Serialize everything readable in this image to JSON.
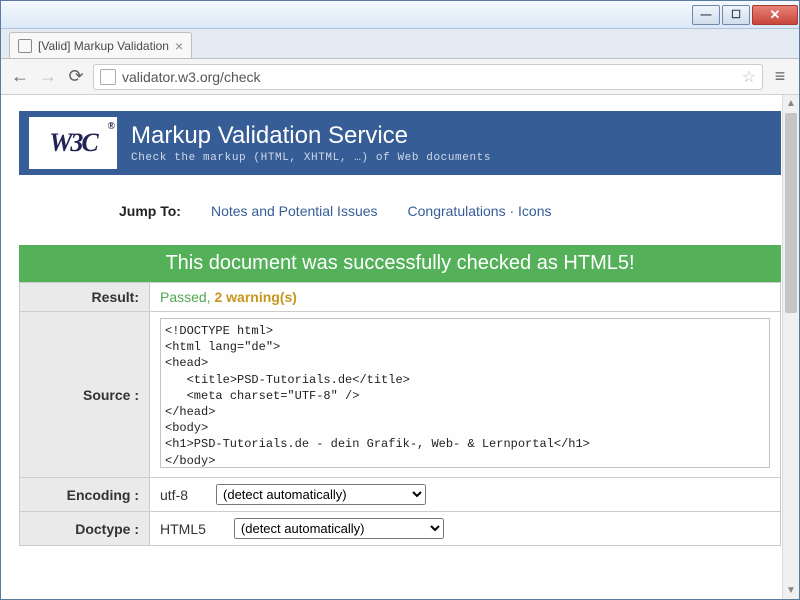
{
  "window": {
    "tab_title": "[Valid] Markup Validation"
  },
  "toolbar": {
    "url": "validator.w3.org/check"
  },
  "banner": {
    "logo_text": "W3C",
    "logo_reg": "®",
    "title": "Markup Validation Service",
    "subtitle": "Check the markup (HTML, XHTML, …) of Web documents"
  },
  "jump": {
    "label": "Jump To:",
    "link1": "Notes and Potential Issues",
    "link2": "Congratulations",
    "link3": "Icons"
  },
  "success_msg": "This document was successfully checked as HTML5!",
  "rows": {
    "result_label": "Result:",
    "result_passed": "Passed, ",
    "result_warn": "2 warning(s)",
    "source_label": "Source :",
    "source_text": "<!DOCTYPE html>\n<html lang=\"de\">\n<head>\n   <title>PSD-Tutorials.de</title>\n   <meta charset=\"UTF-8\" />\n</head>\n<body>\n<h1>PSD-Tutorials.de - dein Grafik-, Web- & Lernportal</h1>\n</body>\n</html>",
    "encoding_label": "Encoding :",
    "encoding_value": "utf-8",
    "encoding_select": "(detect automatically)",
    "doctype_label": "Doctype :",
    "doctype_value": "HTML5",
    "doctype_select": "(detect automatically)"
  }
}
